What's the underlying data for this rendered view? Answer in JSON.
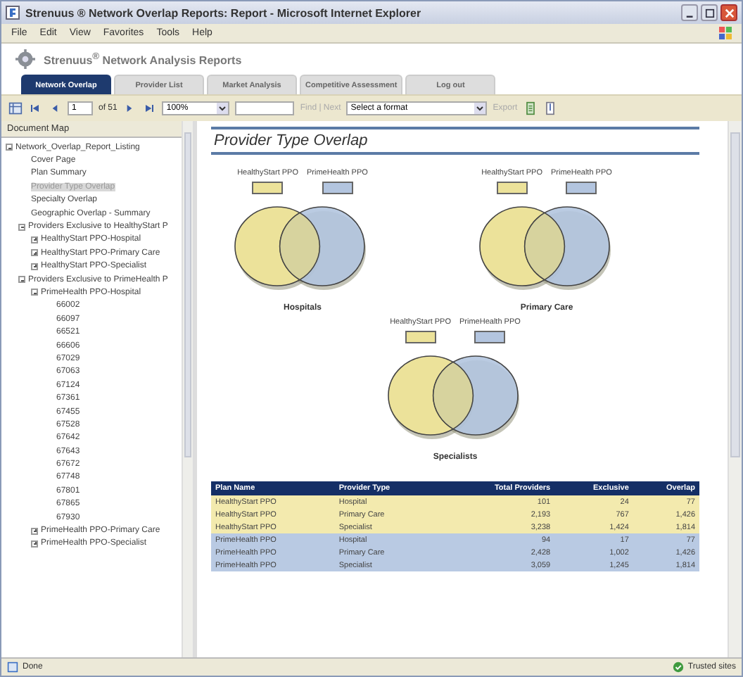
{
  "window": {
    "title": "Strenuus ® Network Overlap Reports: Report - Microsoft Internet Explorer"
  },
  "menu": [
    "File",
    "Edit",
    "View",
    "Favorites",
    "Tools",
    "Help"
  ],
  "app_title": "Strenuus$^{®}$ Network Analysis Reports",
  "tabs": [
    {
      "label": "Network Overlap",
      "selected": true
    },
    {
      "label": "Provider List",
      "selected": false
    },
    {
      "label": "Market Analysis",
      "selected": false
    },
    {
      "label": "Competitive Assessment",
      "selected": false
    },
    {
      "label": "Log out",
      "selected": false
    }
  ],
  "toolbar": {
    "page": "1",
    "page_count": "of 51",
    "zoom": "100%",
    "find_next": "Find | Next",
    "format": "Select a format",
    "export": "Export"
  },
  "document_map": {
    "title": "Document Map",
    "tree": [
      {
        "label": "Network_Overlap_Report_Listing",
        "expanded": true,
        "selected": false,
        "children": [
          {
            "label": "Cover Page",
            "selected": false
          },
          {
            "label": "Plan Summary",
            "selected": false
          },
          {
            "label": "Provider Type Overlap",
            "selected": true
          },
          {
            "label": "Specialty Overlap",
            "selected": false
          },
          {
            "label": "Geographic Overlap - Summary",
            "selected": false
          },
          {
            "label": "Providers Exclusive to HealthyStart P",
            "expanded": true,
            "selected": false,
            "children": [
              {
                "label": "HealthyStart PPO-Hospital",
                "expanded": false,
                "selected": false
              },
              {
                "label": "HealthyStart PPO-Primary Care",
                "expanded": false,
                "selected": false
              },
              {
                "label": "HealthyStart PPO-Specialist",
                "expanded": false,
                "selected": false
              }
            ]
          },
          {
            "label": "Providers Exclusive to PrimeHealth P",
            "expanded": true,
            "selected": false,
            "children": [
              {
                "label": "PrimeHealth PPO-Hospital",
                "expanded": true,
                "selected": false,
                "children": [
                  {
                    "label": "66002",
                    "selected": false
                  },
                  {
                    "label": "66097",
                    "selected": false
                  },
                  {
                    "label": "66521",
                    "selected": false
                  },
                  {
                    "label": "66606",
                    "selected": false
                  },
                  {
                    "label": "67029",
                    "selected": false
                  },
                  {
                    "label": "67063",
                    "selected": false
                  },
                  {
                    "label": "67124",
                    "selected": false
                  },
                  {
                    "label": "67361",
                    "selected": false
                  },
                  {
                    "label": "67455",
                    "selected": false
                  },
                  {
                    "label": "67528",
                    "selected": false
                  },
                  {
                    "label": "67642",
                    "selected": false
                  },
                  {
                    "label": "67643",
                    "selected": false
                  },
                  {
                    "label": "67672",
                    "selected": false
                  },
                  {
                    "label": "67748",
                    "selected": false
                  },
                  {
                    "label": "67801",
                    "selected": false
                  },
                  {
                    "label": "67865",
                    "selected": false
                  },
                  {
                    "label": "67930",
                    "selected": false
                  }
                ]
              },
              {
                "label": "PrimeHealth PPO-Primary Care",
                "expanded": false,
                "selected": false
              },
              {
                "label": "PrimeHealth PPO-Specialist",
                "expanded": false,
                "selected": false
              }
            ]
          }
        ]
      }
    ]
  },
  "report": {
    "title": "Provider Type Overlap",
    "venns": [
      {
        "caption": "Hospitals",
        "legend": [
          {
            "label": "HealthyStart PPO",
            "color": "#ece29a"
          },
          {
            "label": "PrimeHealth PPO",
            "color": "#b3c5df"
          }
        ]
      },
      {
        "caption": "Primary Care",
        "legend": [
          {
            "label": "HealthyStart PPO",
            "color": "#ece29a"
          },
          {
            "label": "PrimeHealth PPO",
            "color": "#b3c5df"
          }
        ]
      },
      {
        "caption": "Specialists",
        "legend": [
          {
            "label": "HealthyStart PPO",
            "color": "#ece29a"
          },
          {
            "label": "PrimeHealth PPO",
            "color": "#b3c5df"
          }
        ]
      }
    ],
    "table": {
      "columns": [
        "Plan Name",
        "Provider Type",
        "Total Providers",
        "Exclusive",
        "Overlap"
      ],
      "rows": [
        {
          "color": "#f3eaae",
          "cells": [
            "HealthyStart PPO",
            "Hospital",
            "101",
            "24",
            "77"
          ]
        },
        {
          "color": "#f3eaae",
          "cells": [
            "HealthyStart PPO",
            "Primary Care",
            "2,193",
            "767",
            "1,426"
          ]
        },
        {
          "color": "#f3eaae",
          "cells": [
            "HealthyStart PPO",
            "Specialist",
            "3,238",
            "1,424",
            "1,814"
          ]
        },
        {
          "color": "#b9cae3",
          "cells": [
            "PrimeHealth PPO",
            "Hospital",
            "94",
            "17",
            "77"
          ]
        },
        {
          "color": "#b9cae3",
          "cells": [
            "PrimeHealth PPO",
            "Primary Care",
            "2,428",
            "1,002",
            "1,426"
          ]
        },
        {
          "color": "#b9cae3",
          "cells": [
            "PrimeHealth PPO",
            "Specialist",
            "3,059",
            "1,245",
            "1,814"
          ]
        }
      ]
    }
  },
  "status_bar": {
    "left": "Done",
    "right": "Trusted sites"
  }
}
